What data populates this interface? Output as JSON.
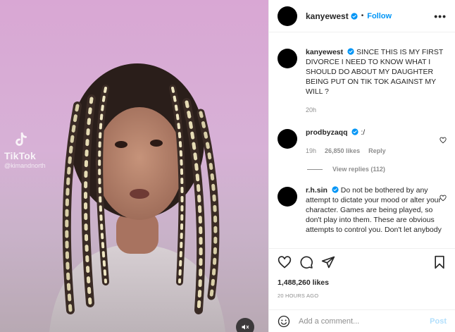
{
  "colors": {
    "accent": "#0095f6",
    "muted": "#8e8e8e",
    "text": "#262626"
  },
  "media": {
    "watermark_brand": "TikTok",
    "watermark_handle": "@kimandnorth",
    "mute_icon": "speaker-muted-icon"
  },
  "header": {
    "username": "kanyewest",
    "separator": "•",
    "follow_label": "Follow",
    "more_label": "•••"
  },
  "caption": {
    "username": "kanyewest",
    "text": "SINCE THIS IS MY FIRST DIVORCE I NEED TO KNOW WHAT I SHOULD DO ABOUT MY DAUGHTER BEING PUT ON TIK TOK AGAINST MY WILL ?",
    "time": "20h"
  },
  "comments": [
    {
      "username": "prodbyzaqq",
      "text": ":/",
      "time": "19h",
      "likes": "26,850 likes",
      "reply_label": "Reply",
      "view_replies": "View replies (112)"
    },
    {
      "username": "r.h.sin",
      "text": "Do not be bothered by any attempt to dictate your mood or alter your character. Games are being played, so don't play into them. These are obvious attempts to control you. Don't let anybody"
    }
  ],
  "actions": {
    "icons": [
      "heart-icon",
      "comment-icon",
      "share-icon",
      "bookmark-icon"
    ],
    "likes": "1,488,260 likes",
    "timestamp": "20 HOURS AGO"
  },
  "add_comment": {
    "placeholder": "Add a comment...",
    "post_label": "Post"
  }
}
